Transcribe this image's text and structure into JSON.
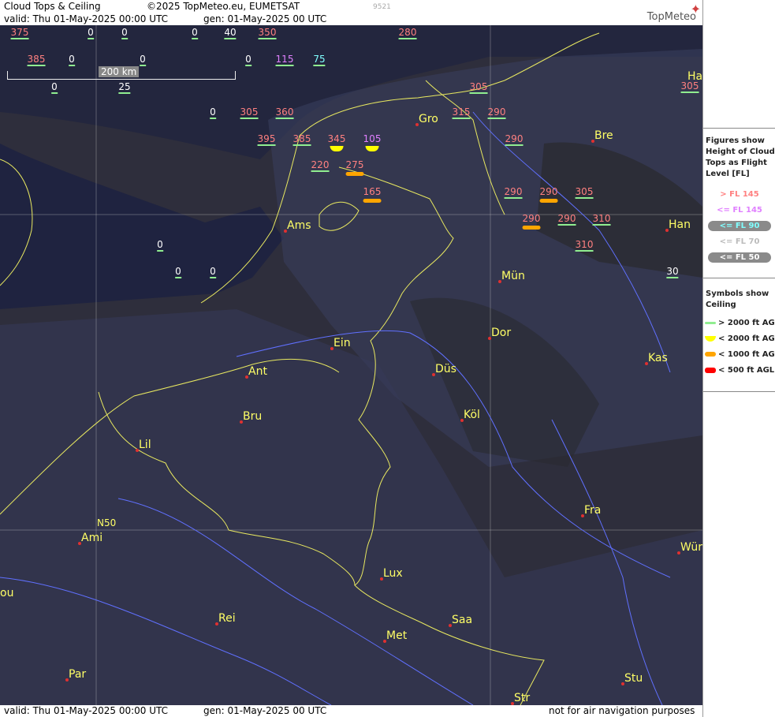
{
  "header": {
    "title": "Cloud Tops & Ceiling",
    "copyright": "©2025 TopMeteo.eu, EUMETSAT",
    "valid": "valid:  Thu  01-May-2025  00:00 UTC",
    "gen": "gen: 01-May-2025 00 UTC",
    "id": "9521",
    "logo": "TopMeteo"
  },
  "footer": {
    "valid": "valid:  Thu  01-May-2025  00:00 UTC",
    "gen": "gen: 01-May-2025 00 UTC",
    "note": "not for air navigation purposes"
  },
  "scale_label": "200 km",
  "grid_label": "N50",
  "legend": {
    "figures_title": "Figures show Height of Cloud Tops as Flight Level  [FL]",
    "fl_items": [
      {
        "label": "> FL 145",
        "color": "#ff8080"
      },
      {
        "label": "<= FL 145",
        "color": "#e080ff"
      },
      {
        "label": "<= FL 90",
        "color": "#80ffff"
      },
      {
        "label": "<= FL 70",
        "color": "#bbbbbb"
      },
      {
        "label": "<= FL 50",
        "color": "#ffffff"
      }
    ],
    "symbols_title": "Symbols show Ceiling",
    "sym_items": [
      {
        "label": "> 2000 ft AGL",
        "color": "#90ee90"
      },
      {
        "label": "< 2000 ft AGL",
        "color": "#ffff00"
      },
      {
        "label": "< 1000 ft AGL",
        "color": "#ffa500"
      },
      {
        "label": "< 500 ft AGL",
        "color": "#ff0000"
      }
    ]
  },
  "cities": [
    "Gro",
    "Bre",
    "Ams",
    "Han",
    "Mün",
    "Dor",
    "Ein",
    "Ant",
    "Düs",
    "Kas",
    "Köl",
    "Bru",
    "Lil",
    "Fra",
    "Ami",
    "Wür",
    "Lux",
    "Saa",
    "Rei",
    "Met",
    "Par",
    "Stu",
    "Str",
    "Ha",
    "ou"
  ],
  "values": [
    "375",
    "0",
    "0",
    "0",
    "40",
    "350",
    "280",
    "385",
    "0",
    "0",
    "0",
    "115",
    "75",
    "0",
    "25",
    "305",
    "0",
    "305",
    "360",
    "315",
    "290",
    "395",
    "385",
    "345",
    "105",
    "290",
    "Bre",
    "220",
    "275",
    "165",
    "290",
    "290",
    "305",
    "290",
    "290",
    "310",
    "310",
    "0",
    "0",
    "0",
    "30"
  ]
}
